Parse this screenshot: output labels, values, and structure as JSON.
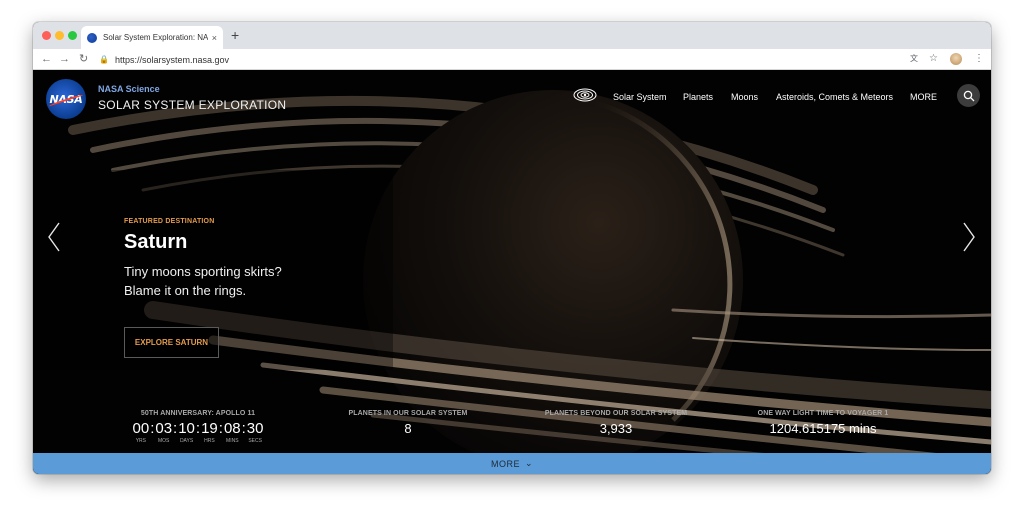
{
  "browser": {
    "tab_title": "Solar System Exploration: NAS",
    "tab_close": "×",
    "new_tab": "+",
    "url": "https://solarsystem.nasa.gov"
  },
  "site": {
    "brand_sub": "NASA Science",
    "brand_title": "SOLAR SYSTEM EXPLORATION",
    "logo_text": "NASA",
    "nav": [
      "Solar System",
      "Planets",
      "Moons",
      "Asteroids, Comets & Meteors",
      "MORE"
    ]
  },
  "feature": {
    "kicker": "FEATURED DESTINATION",
    "title": "Saturn",
    "description": "Tiny moons sporting skirts? Blame it on the rings.",
    "button": "EXPLORE SATURN"
  },
  "stats": {
    "apollo": {
      "label": "50TH ANNIVERSARY: APOLLO 11",
      "values": [
        "00",
        "03",
        "10",
        "19",
        "08",
        "30"
      ],
      "units": [
        "YRS",
        "MOS",
        "DAYS",
        "HRS",
        "MINS",
        "SECS"
      ]
    },
    "planets": {
      "label": "PLANETS IN OUR SOLAR SYSTEM",
      "value": "8"
    },
    "beyond": {
      "label": "PLANETS BEYOND OUR SOLAR SYSTEM",
      "value": "3,933"
    },
    "voyager": {
      "label": "ONE WAY LIGHT TIME TO VOYAGER 1",
      "value": "1204.615175 mins"
    }
  },
  "more_bar": {
    "label": "MORE"
  },
  "colors": {
    "accent": "#e39b4c",
    "more_bar": "#5b9bd8",
    "nasa_blue": "#0b3d91"
  }
}
